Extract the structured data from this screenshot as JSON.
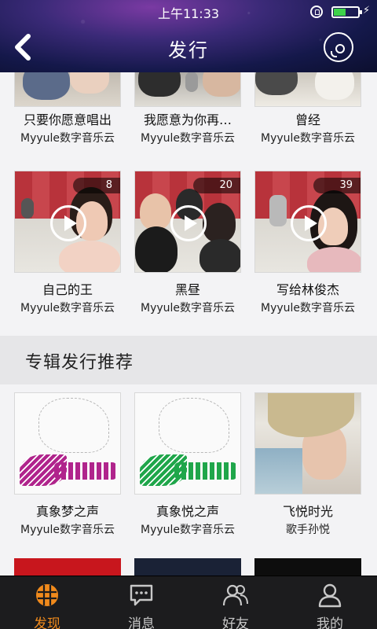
{
  "status_bar": {
    "time": "上午11:33",
    "battery_level": 0.5,
    "charging_icon": "lightning-icon",
    "lock_icon": "rotation-lock-icon"
  },
  "header": {
    "title": "发行",
    "back_icon": "chevron-left-icon",
    "right_icon": "disc-icon"
  },
  "releases": [
    {
      "title": "只要你愿意唱出",
      "subtitle": "Myyule数字音乐云",
      "count": ""
    },
    {
      "title": "我愿意为你再…",
      "subtitle": "Myyule数字音乐云",
      "count": ""
    },
    {
      "title": "曾经",
      "subtitle": "Myyule数字音乐云",
      "count": ""
    },
    {
      "title": "自己的王",
      "subtitle": "Myyule数字音乐云",
      "count": "8"
    },
    {
      "title": "黑昼",
      "subtitle": "Myyule数字音乐云",
      "count": "20"
    },
    {
      "title": "写给林俊杰",
      "subtitle": "Myyule数字音乐云",
      "count": "39"
    }
  ],
  "album_section": {
    "title": "专辑发行推荐",
    "albums": [
      {
        "title": "真象梦之声",
        "subtitle": "Myyule数字音乐云",
        "wing_color": "#b0248c"
      },
      {
        "title": "真象悦之声",
        "subtitle": "Myyule数字音乐云",
        "wing_color": "#1fa64a"
      },
      {
        "title": "飞悦时光",
        "subtitle": "歌手孙悦",
        "wing_color": ""
      }
    ]
  },
  "tabbar": {
    "active_color": "#f08a1c",
    "tabs": [
      {
        "label": "发现",
        "icon": "globe-icon",
        "active": true
      },
      {
        "label": "消息",
        "icon": "chat-bubble-icon",
        "active": false
      },
      {
        "label": "好友",
        "icon": "friends-icon",
        "active": false
      },
      {
        "label": "我的",
        "icon": "person-icon",
        "active": false
      }
    ]
  }
}
